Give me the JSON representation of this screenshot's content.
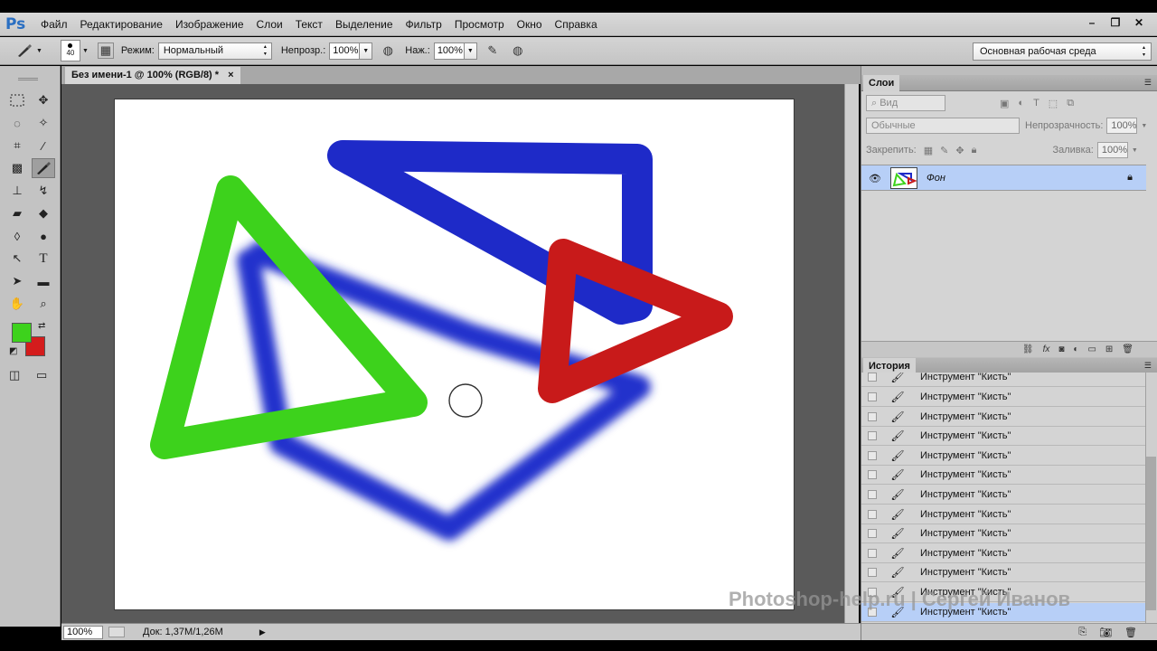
{
  "app": {
    "logo": "Ps"
  },
  "menu": [
    "Файл",
    "Редактирование",
    "Изображение",
    "Слои",
    "Текст",
    "Выделение",
    "Фильтр",
    "Просмотр",
    "Окно",
    "Справка"
  ],
  "window_controls": {
    "minimize": "–",
    "restore": "❐",
    "close": "✕"
  },
  "options": {
    "brush_size": "40",
    "mode_label": "Режим:",
    "mode_value": "Нормальный",
    "opacity_label": "Непрозр.:",
    "opacity_value": "100%",
    "pressure_label": "Наж.:",
    "pressure_value": "100%"
  },
  "workspace_select": "Основная рабочая среда",
  "document": {
    "tab_title": "Без имени-1 @ 100% (RGB/8) *",
    "tab_close": "×"
  },
  "status": {
    "zoom": "100%",
    "doc_info": "Док: 1,37M/1,26M"
  },
  "colors": {
    "foreground": "#3dd21c",
    "background": "#d41c1c",
    "blue_stroke": "#1e2ac8"
  },
  "layers_panel": {
    "tab": "Слои",
    "filter_placeholder": "Вид",
    "blend": "Обычные",
    "opacity_label": "Непрозрачность:",
    "opacity_value": "100%",
    "lock_label": "Закрепить:",
    "fill_label": "Заливка:",
    "fill_value": "100%",
    "layer_name": "Фон"
  },
  "history_panel": {
    "tab": "История",
    "items": [
      "Инструмент \"Кисть\"",
      "Инструмент \"Кисть\"",
      "Инструмент \"Кисть\"",
      "Инструмент \"Кисть\"",
      "Инструмент \"Кисть\"",
      "Инструмент \"Кисть\"",
      "Инструмент \"Кисть\"",
      "Инструмент \"Кисть\"",
      "Инструмент \"Кисть\"",
      "Инструмент \"Кисть\"",
      "Инструмент \"Кисть\"",
      "Инструмент \"Кисть\"",
      "Инструмент \"Кисть\""
    ]
  },
  "watermark": "Photoshop-help.ru | Сергей Иванов"
}
